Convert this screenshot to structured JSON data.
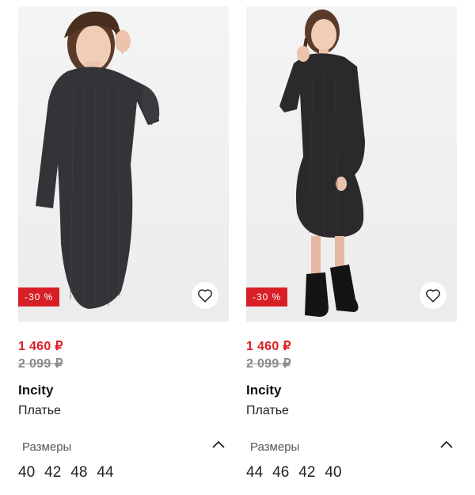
{
  "products": [
    {
      "discount_badge": "-30 %",
      "price_new": "1 460 ₽",
      "price_old": "2 099 ₽",
      "brand": "Incity",
      "product_type": "Платье",
      "sizes_label": "Размеры",
      "sizes": [
        "40",
        "42",
        "48",
        "44"
      ],
      "favorite_icon": "heart-outline-icon",
      "collapse_icon": "chevron-up-icon",
      "dress_color": "#333338"
    },
    {
      "discount_badge": "-30 %",
      "price_new": "1 460 ₽",
      "price_old": "2 099 ₽",
      "brand": "Incity",
      "product_type": "Платье",
      "sizes_label": "Размеры",
      "sizes": [
        "44",
        "46",
        "42",
        "40"
      ],
      "favorite_icon": "heart-outline-icon",
      "collapse_icon": "chevron-up-icon",
      "dress_color": "#2a2a2d"
    }
  ],
  "colors": {
    "accent_red": "#d81f26",
    "old_price_gray": "#8a8a8a"
  }
}
